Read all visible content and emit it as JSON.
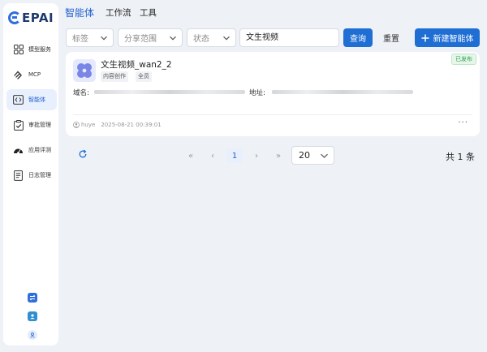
{
  "brand": {
    "logo_text": "EPAI"
  },
  "sidebar": {
    "items": [
      {
        "label": "模型服务",
        "icon": "grid-icon"
      },
      {
        "label": "MCP",
        "icon": "mcp-icon"
      },
      {
        "label": "智能体",
        "icon": "agent-icon",
        "active": true
      },
      {
        "label": "审批管理",
        "icon": "clipboard-check-icon"
      },
      {
        "label": "应用评测",
        "icon": "gauge-icon"
      },
      {
        "label": "日志管理",
        "icon": "document-icon"
      }
    ]
  },
  "top_tabs": [
    "智能体",
    "工作流",
    "工具"
  ],
  "filters": {
    "tag_placeholder": "标签",
    "share_placeholder": "分享范围",
    "status_placeholder": "状态",
    "search_value": "文生视频",
    "query_label": "查询",
    "reset_label": "重置",
    "new_label": "新建智能体"
  },
  "card": {
    "status": "已发布",
    "title": "文生视频_wan2_2",
    "tags": [
      "内容创作",
      "全员"
    ],
    "domain_label": "域名:",
    "address_label": "地址:",
    "user": "huye",
    "timestamp": "2025-08-21 00:39:01",
    "more": "···"
  },
  "pagination": {
    "first": "«",
    "prev": "‹",
    "current": "1",
    "next": "›",
    "last": "»",
    "page_size": "20",
    "total": "共 1 条"
  },
  "colors": {
    "accent": "#1f6ed4",
    "published": "#2aa24b"
  }
}
